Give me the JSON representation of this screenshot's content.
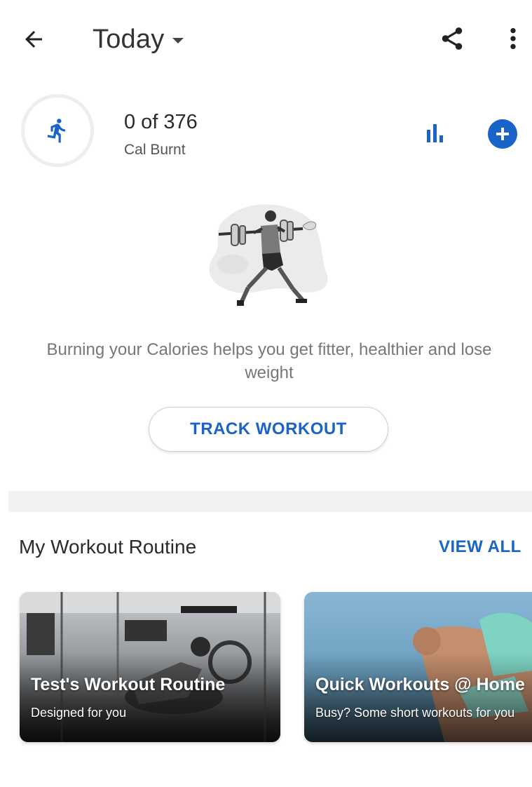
{
  "header": {
    "title": "Today",
    "icons": {
      "back": "arrow-back-icon",
      "dropdown": "caret-down-icon",
      "share": "share-icon",
      "more": "more-vert-icon"
    }
  },
  "summary": {
    "value": "0 of 376",
    "label": "Cal Burnt",
    "progress_fraction": 0,
    "icons": {
      "activity": "running-person-icon",
      "chart": "bar-chart-icon",
      "add": "add-circle-icon"
    }
  },
  "empty_state": {
    "illustration": "barbell-lunge-illustration",
    "message": "Burning your Calories helps you get fitter, healthier and lose weight",
    "button_label": "TRACK WORKOUT"
  },
  "routines": {
    "title": "My Workout Routine",
    "view_all_label": "VIEW ALL",
    "cards": [
      {
        "title": "Test's Workout Routine",
        "subtitle": "Designed for you"
      },
      {
        "title": "Quick Workouts @ Home",
        "subtitle": "Busy? Some short workouts for you"
      }
    ]
  },
  "colors": {
    "accent": "#1a63c8",
    "text_primary": "#2a2a2a",
    "text_secondary": "#777777",
    "divider": "#f2f2f2"
  }
}
